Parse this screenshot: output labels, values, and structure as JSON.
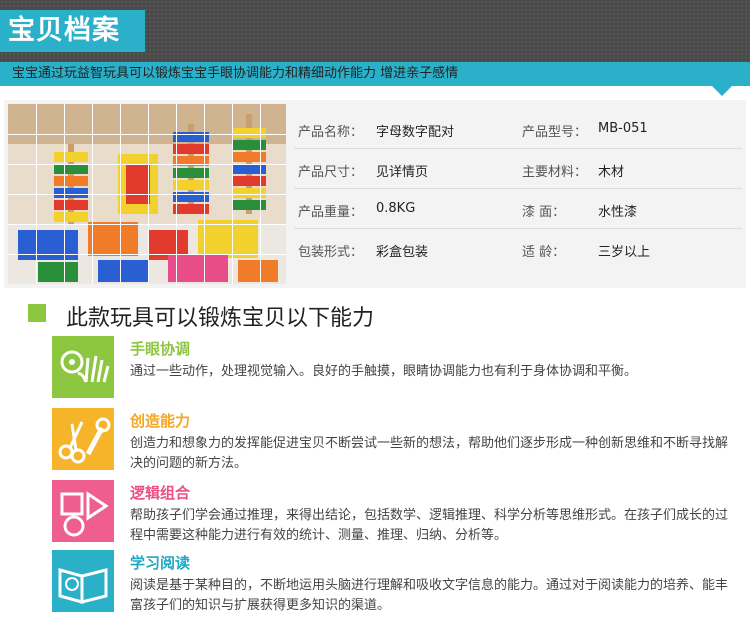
{
  "header": {
    "title": "宝贝档案",
    "subtitle": "宝宝通过玩益智玩具可以锻炼宝宝手眼协调能力和精细动作能力  增进亲子感情"
  },
  "product": {
    "specs": [
      {
        "label_left": "产品名称：",
        "value_left": "字母数字配对",
        "label_right": "产品型号：",
        "value_right": "MB-051"
      },
      {
        "label_left": "产品尺寸：",
        "value_left": "见详情页",
        "label_right": "主要材料：",
        "value_right": "木材"
      },
      {
        "label_left": "产品重量：",
        "value_left": "0.8KG",
        "label_right": "漆      面：",
        "value_right": "水性漆"
      },
      {
        "label_left": "包装形式：",
        "value_left": "彩盒包装",
        "label_right": "适      龄：",
        "value_right": "三岁以上"
      }
    ]
  },
  "section": {
    "title": "此款玩具可以锻炼宝贝以下能力"
  },
  "abilities": [
    {
      "title": "手眼协调",
      "desc": "通过一些动作，处理视觉输入。良好的手触摸，眼睛协调能力也有利于身体协调和平衡。",
      "color": "#8dc63f",
      "title_color": "#8dc63f",
      "icon": "eye-hand-icon"
    },
    {
      "title": "创造能力",
      "desc": "创造力和想象力的发挥能促进宝贝不断尝试一些新的想法，帮助他们逐步形成一种创新思维和不断寻找解决的问题的新方法。",
      "color": "#f5b42a",
      "title_color": "#f5a623",
      "icon": "scissors-wrench-icon"
    },
    {
      "title": "逻辑组合",
      "desc": "帮助孩子们学会通过推理，来得出结论，包括数学、逻辑推理、科学分析等思维形式。在孩子们成长的过程中需要这种能力进行有效的统计、测量、推理、归纳、分析等。",
      "color": "#ee5e8f",
      "title_color": "#ee4f86",
      "icon": "shapes-icon"
    },
    {
      "title": "学习阅读",
      "desc": "阅读是基于某种目的，不断地运用头脑进行理解和吸收文字信息的能力。通过对于阅读能力的培养、能丰富孩子们的知识与扩展获得更多知识的渠道。",
      "color": "#2bb0c9",
      "title_color": "#1fa8c4",
      "icon": "book-icon"
    }
  ]
}
